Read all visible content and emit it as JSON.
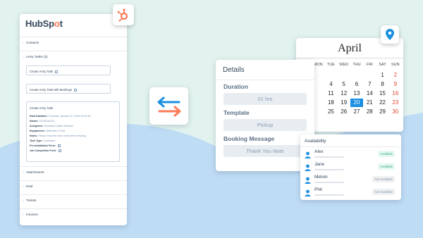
{
  "colors": {
    "bg": "#e2f3ef",
    "blob": "#bfdcf5",
    "hubspot_orange": "#ff7a59",
    "accent_blue": "#1b8fe0",
    "weekend_red": "#e0472f"
  },
  "hubspot": {
    "logo": {
      "prefix": "HubSp",
      "dot": "o",
      "suffix": "t"
    },
    "contacts": "Contacts",
    "army_tasks": "Army Tasks (3)",
    "create_btn_1": "Create Army Task",
    "create_btn_2": "Create Army Task with Bookings",
    "task": {
      "title": "Create Army Task",
      "start_label": "Start Datetime:",
      "start_value": "Thursday, January 20, 2026 10:54 am",
      "status_label": "Status:",
      "status_value": "SCHEDULED",
      "assignees_label": "Assignees:",
      "assignees_value": "Shamlanin Basim Bhasani",
      "equipments_label": "Equipments:",
      "equipments_value": "Multimeter & Drill",
      "notes_label": "Notes:",
      "notes_value": "Please keep the area ceiled before leaving",
      "type_label": "Task Type:",
      "type_value": "Installation",
      "pre_form_label": "Pre-Installation Form:",
      "job_form_label": "Job Completion Form:"
    },
    "attachments": "Attachments",
    "deal": "Deal",
    "tickets": "Tickets",
    "invoices": "Invoices"
  },
  "details": {
    "title": "Details",
    "duration_label": "Duration",
    "duration_value": "01 hrs",
    "template_label": "Template",
    "template_value": "Pickup",
    "booking_label": "Booking Message",
    "booking_value": "Thank You Note"
  },
  "calendar": {
    "month": "April",
    "days": [
      "MON",
      "TUE",
      "WED",
      "THU",
      "FRI",
      "SAT",
      "SUN"
    ],
    "rows": [
      [
        "",
        "",
        "",
        "",
        "1",
        "2"
      ],
      [
        "4",
        "5",
        "6",
        "7",
        "8",
        "9"
      ],
      [
        "11",
        "12",
        "13",
        "14",
        "15",
        "16"
      ],
      [
        "18",
        "19",
        "20",
        "21",
        "22",
        "23"
      ],
      [
        "25",
        "26",
        "27",
        "28",
        "29",
        "30"
      ]
    ],
    "selected": "20"
  },
  "availability": {
    "title": "Availability",
    "people": [
      {
        "name": "Alex",
        "status": "Available"
      },
      {
        "name": "Jane",
        "status": "Available"
      },
      {
        "name": "Melvin",
        "status": "Not Available"
      },
      {
        "name": "Phil",
        "status": "Not Available"
      }
    ]
  }
}
